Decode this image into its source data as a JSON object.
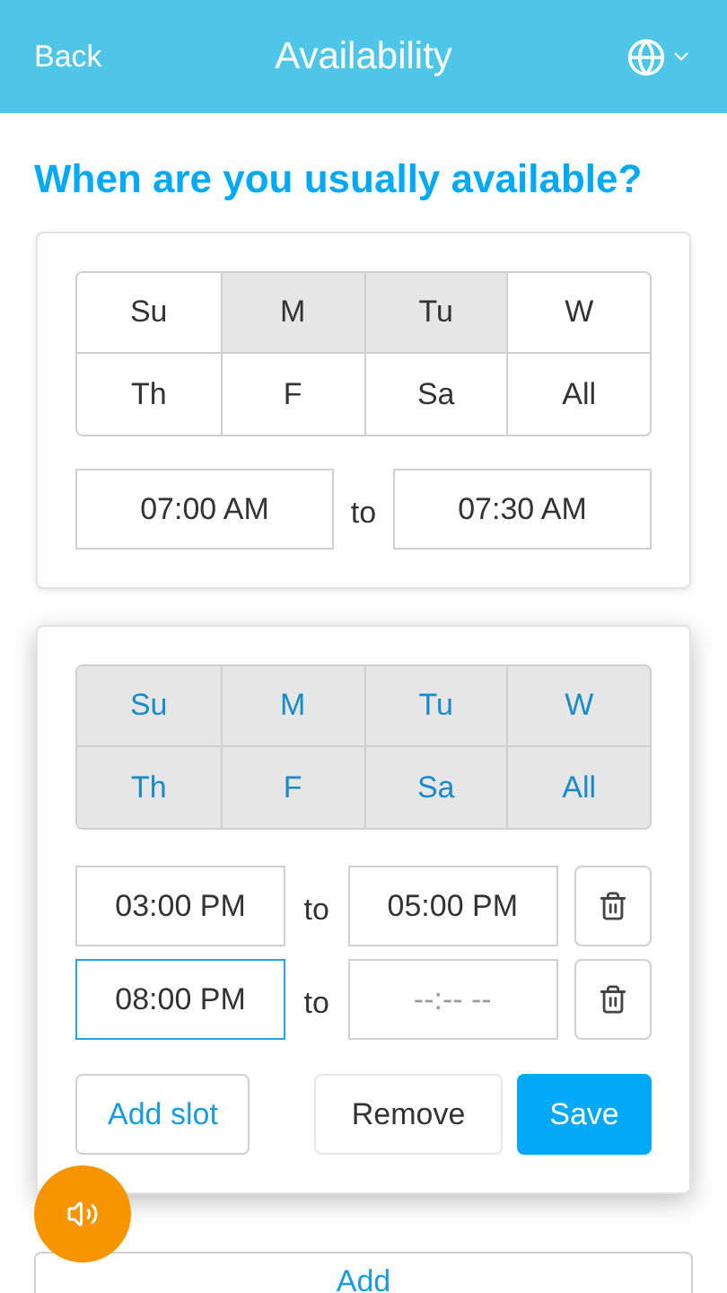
{
  "header": {
    "back": "Back",
    "title": "Availability"
  },
  "heading": "When are you usually available?",
  "cards": [
    {
      "editing": false,
      "days": [
        {
          "label": "Su",
          "selected": false
        },
        {
          "label": "M",
          "selected": true
        },
        {
          "label": "Tu",
          "selected": true
        },
        {
          "label": "W",
          "selected": false
        },
        {
          "label": "Th",
          "selected": false
        },
        {
          "label": "F",
          "selected": false
        },
        {
          "label": "Sa",
          "selected": false
        },
        {
          "label": "All",
          "selected": false
        }
      ],
      "slots": [
        {
          "start": {
            "value": "07:00 AM",
            "focused": false
          },
          "to": "to",
          "end": {
            "value": "07:30 AM",
            "focused": false
          }
        }
      ]
    },
    {
      "editing": true,
      "days": [
        {
          "label": "Su",
          "selected": true
        },
        {
          "label": "M",
          "selected": true
        },
        {
          "label": "Tu",
          "selected": true
        },
        {
          "label": "W",
          "selected": true
        },
        {
          "label": "Th",
          "selected": true
        },
        {
          "label": "F",
          "selected": true
        },
        {
          "label": "Sa",
          "selected": true
        },
        {
          "label": "All",
          "selected": true
        }
      ],
      "slots": [
        {
          "start": {
            "value": "03:00 PM",
            "focused": false
          },
          "to": "to",
          "end": {
            "value": "05:00 PM",
            "focused": false
          }
        },
        {
          "start": {
            "value": "08:00 PM",
            "focused": true
          },
          "to": "to",
          "end": {
            "placeholder": "--:-- --",
            "focused": false
          }
        }
      ],
      "actions": {
        "add_slot": "Add slot",
        "remove": "Remove",
        "save": "Save"
      }
    }
  ],
  "add": "Add"
}
